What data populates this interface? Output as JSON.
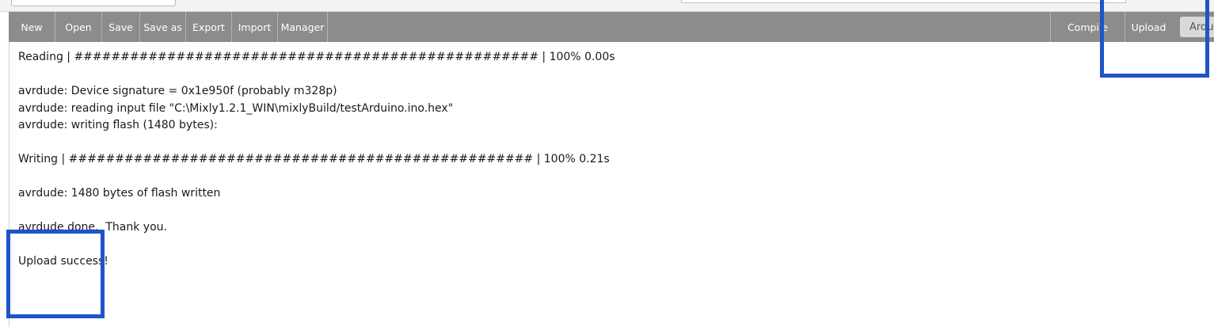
{
  "toolbar": {
    "buttons": [
      "New",
      "Open",
      "Save",
      "Save as",
      "Export",
      "Import",
      "Manager"
    ],
    "compile_label": "Compile",
    "upload_label": "Upload",
    "board_label": "Arduino"
  },
  "console": {
    "lines": [
      "Reading | ################################################## | 100% 0.00s",
      "",
      "avrdude: Device signature = 0x1e950f (probably m328p)",
      "avrdude: reading input file \"C:\\Mixly1.2.1_WIN\\mixlyBuild/testArduino.ino.hex\"",
      "avrdude: writing flash (1480 bytes):",
      "",
      "Writing | ################################################## | 100% 0.21s",
      "",
      "avrdude: 1480 bytes of flash written",
      "",
      "avrdude done.  Thank you.",
      "",
      "Upload success!"
    ]
  },
  "colors": {
    "toolbar_bg": "#8c8c8c",
    "highlight_box": "#1f54c8"
  }
}
